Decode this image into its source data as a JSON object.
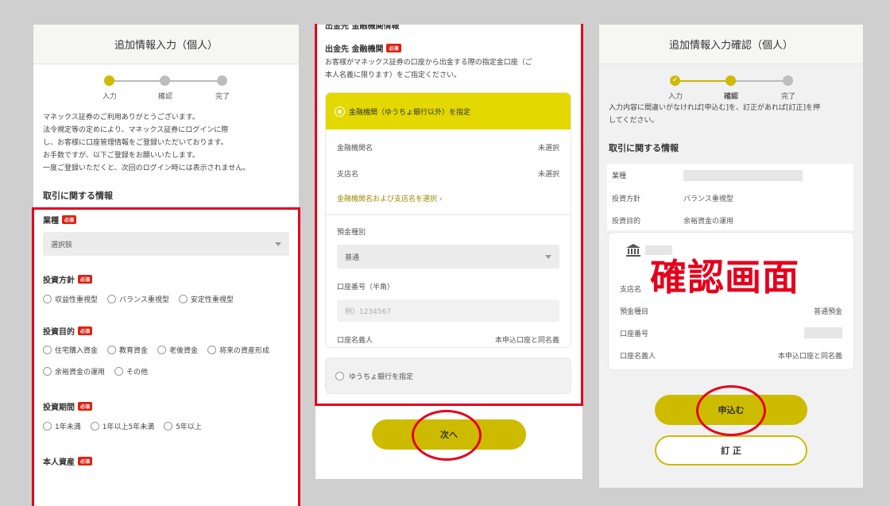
{
  "panel1": {
    "title": "追加情報入力（個人）",
    "steps": [
      "入力",
      "確認",
      "完了"
    ],
    "intro": [
      "マネックス証券のご利用ありがとうございます。",
      "法令規定等の定めにより、マネックス証券にログインに際",
      "し、お客様に口座管理情報をご登録いただいております。",
      "お手数ですが、以下ご登録をお願いいたします。",
      "一度ご登録いただくと、次回のログイン時には表示されません。"
    ],
    "section_title": "取引に関する情報",
    "required": "必須",
    "occupation": {
      "label": "業種",
      "placeholder": "選択肢"
    },
    "policy": {
      "label": "投資方針",
      "options": [
        "収益性重視型",
        "バランス重視型",
        "安定性重視型"
      ]
    },
    "purpose": {
      "label": "投資目的",
      "options": [
        "住宅購入資金",
        "教育資金",
        "老後資金",
        "将来の資産形成",
        "余裕資金の運用",
        "その他"
      ]
    },
    "period": {
      "label": "投資期間",
      "options": [
        "1年未満",
        "1年以上5年未満",
        "5年以上"
      ]
    },
    "assets": {
      "label": "本人資産"
    }
  },
  "panel2": {
    "top_cut": "出金先 金融機関情報",
    "title": "出金先 金融機関",
    "required": "必須",
    "desc": [
      "お客様がマネックス証券の口座から出金する際の指定金口座（ご",
      "本人名義に限ります）をご指定ください。"
    ],
    "bank_option": "金融機関（ゆうちょ銀行以外）を指定",
    "bank_name_label": "金融機関名",
    "bank_name_value": "未選択",
    "branch_label": "支店名",
    "branch_value": "未選択",
    "select_link": "金融機関名および支店名を選択 ›",
    "type_label": "預金種別",
    "type_value": "普通",
    "number_label": "口座番号（半角）",
    "number_placeholder": "例）1234567",
    "holder_label": "口座名義人",
    "holder_value": "本申込口座と同名義",
    "yucho_option": "ゆうちょ銀行を指定",
    "next_button": "次へ"
  },
  "panel3": {
    "title": "追加情報入力確認（個人）",
    "steps": [
      "入力",
      "確認",
      "完了"
    ],
    "check_mark": "✓",
    "intro": [
      "入力内容に間違いがなければ[申込む]を、訂正があれば[訂正]を押",
      "してください。"
    ],
    "section_title": "取引に関する情報",
    "rows": [
      {
        "label": "業種",
        "value": ""
      },
      {
        "label": "投資方針",
        "value": "バランス重視型"
      },
      {
        "label": "投資目的",
        "value": "余裕資金の運用"
      }
    ],
    "bank_icon": "bank-icon",
    "branch_label": "支店名",
    "type_label": "預金種目",
    "type_value": "普通預金",
    "number_label": "口座番号",
    "holder_label": "口座名義人",
    "holder_value": "本申込口座と同名義",
    "apply_button": "申込む",
    "edit_button": "訂 正"
  },
  "annotation": {
    "stamp_text": "確認画面"
  }
}
